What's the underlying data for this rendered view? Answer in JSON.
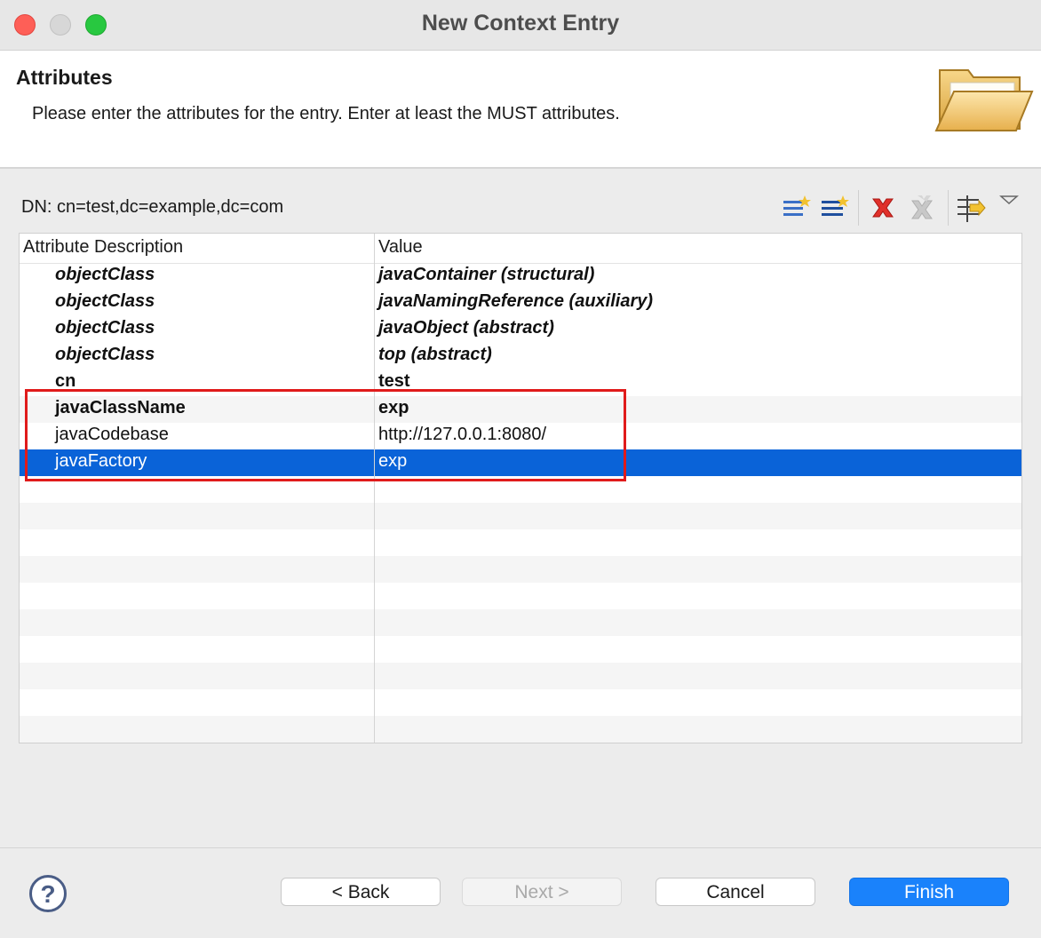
{
  "window": {
    "title": "New Context Entry"
  },
  "header": {
    "title": "Attributes",
    "message": "Please enter the attributes for the entry. Enter at least the MUST attributes."
  },
  "dn": "DN: cn=test,dc=example,dc=com",
  "toolbar": {
    "icons": [
      "new-attribute-icon",
      "new-value-icon",
      "delete-icon",
      "delete-all-icon",
      "show-decorations-icon",
      "view-menu-icon"
    ]
  },
  "table": {
    "columns": [
      "Attribute Description",
      "Value"
    ],
    "rows": [
      {
        "attr": "objectClass",
        "value": "javaContainer (structural)"
      },
      {
        "attr": "objectClass",
        "value": "javaNamingReference (auxiliary)"
      },
      {
        "attr": "objectClass",
        "value": "javaObject (abstract)"
      },
      {
        "attr": "objectClass",
        "value": "top (abstract)"
      },
      {
        "attr": "cn",
        "value": "test"
      },
      {
        "attr": "javaClassName",
        "value": "exp"
      },
      {
        "attr": "javaCodebase",
        "value": "http://127.0.0.1:8080/"
      },
      {
        "attr": "javaFactory",
        "value": "exp"
      }
    ],
    "selected_row": "javaFactory"
  },
  "footer": {
    "back": "< Back",
    "next": "Next >",
    "cancel": "Cancel",
    "finish": "Finish"
  },
  "colors": {
    "selection": "#0a63d8",
    "finish_button": "#1a82fb",
    "highlight_box": "#e01b1b"
  }
}
